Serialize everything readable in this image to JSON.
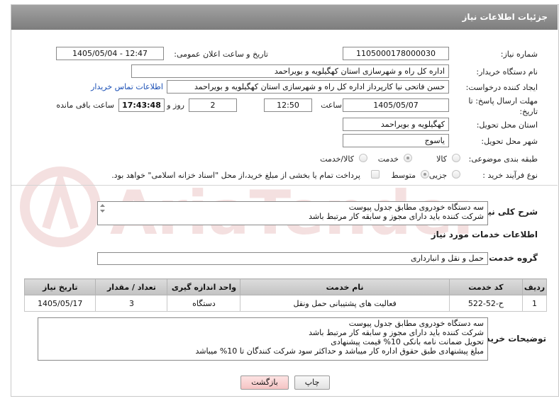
{
  "header": {
    "title": "جزئیات اطلاعات نیاز"
  },
  "fields": {
    "need_number_label": "شماره نیاز:",
    "need_number": "1105000178000030",
    "announce_label": "تاریخ و ساعت اعلان عمومی:",
    "announce_value": "1405/05/04 - 12:47",
    "buyer_org_label": "نام دستگاه خریدار:",
    "buyer_org": "اداره کل راه و شهرسازی استان کهگیلویه و بویراحمد",
    "requester_label": "ایجاد کننده درخواست:",
    "requester": "حسن فاتحی نیا کارپرداز اداره کل راه و شهرسازی استان کهگیلویه و بویراحمد",
    "contact_link": "اطلاعات تماس خریدار",
    "deadline_label_1": "مهلت ارسال پاسخ: تا",
    "deadline_label_2": "تاریخ:",
    "deadline_date": "1405/05/07",
    "time_label": "ساعت",
    "deadline_time": "12:50",
    "days": "2",
    "days_label": "روز و",
    "remaining_time": "17:43:48",
    "remaining_label": "ساعت باقی مانده",
    "province_label": "استان محل تحویل:",
    "province": "کهگیلویه و بویراحمد",
    "city_label": "شهر محل تحویل:",
    "city": "یاسوج",
    "category_label": "طبقه بندی موضوعی:",
    "category_options": [
      "کالا",
      "خدمت",
      "کالا/خدمت"
    ],
    "category_selected": "خدمت",
    "process_label": "نوع فرآیند خرید :",
    "process_options": [
      "جزیی",
      "متوسط"
    ],
    "process_selected": "متوسط",
    "payment_note": "پرداخت تمام یا بخشی از مبلغ خرید،از محل \"اسناد خزانه اسلامی\" خواهد بود."
  },
  "summary": {
    "label": "شرح کلی نیاز:",
    "lines": [
      "سه دستگاه خودروی مطابق جدول پیوست",
      "شرکت کننده باید دارای مجوز و سابقه کار مرتبط باشد"
    ]
  },
  "services": {
    "section_title": "اطلاعات خدمات مورد نیاز",
    "group_label": "گروه خدمت:",
    "group_value": "حمل و نقل و انبارداری",
    "columns": [
      "ردیف",
      "کد خدمت",
      "نام خدمت",
      "واحد اندازه گیری",
      "تعداد / مقدار",
      "تاریخ نیاز"
    ],
    "rows": [
      {
        "index": "1",
        "code": "ح-52-522",
        "name": "فعالیت های پشتیبانی حمل ونقل",
        "unit": "دستگاه",
        "qty": "3",
        "date": "1405/05/17"
      }
    ]
  },
  "notes": {
    "label": "توضیحات خریدار:",
    "lines": [
      "سه دستگاه خودروی مطابق جدول پیوست",
      "شرکت کننده باید دارای مجوز و سابقه کار مرتبط باشد",
      "تحویل ضمانت نامه بانکی 10% قیمت پیشنهادی",
      "مبلغ پیشنهادی طبق حقوق اداره کار میباشد و  حداکثر سود شرکت کنندگان تا 10% میباشد"
    ]
  },
  "buttons": {
    "print": "چاپ",
    "back": "بازگشت"
  },
  "watermark": {
    "text": "AriaTender.net",
    "color": "#b31b1b"
  }
}
